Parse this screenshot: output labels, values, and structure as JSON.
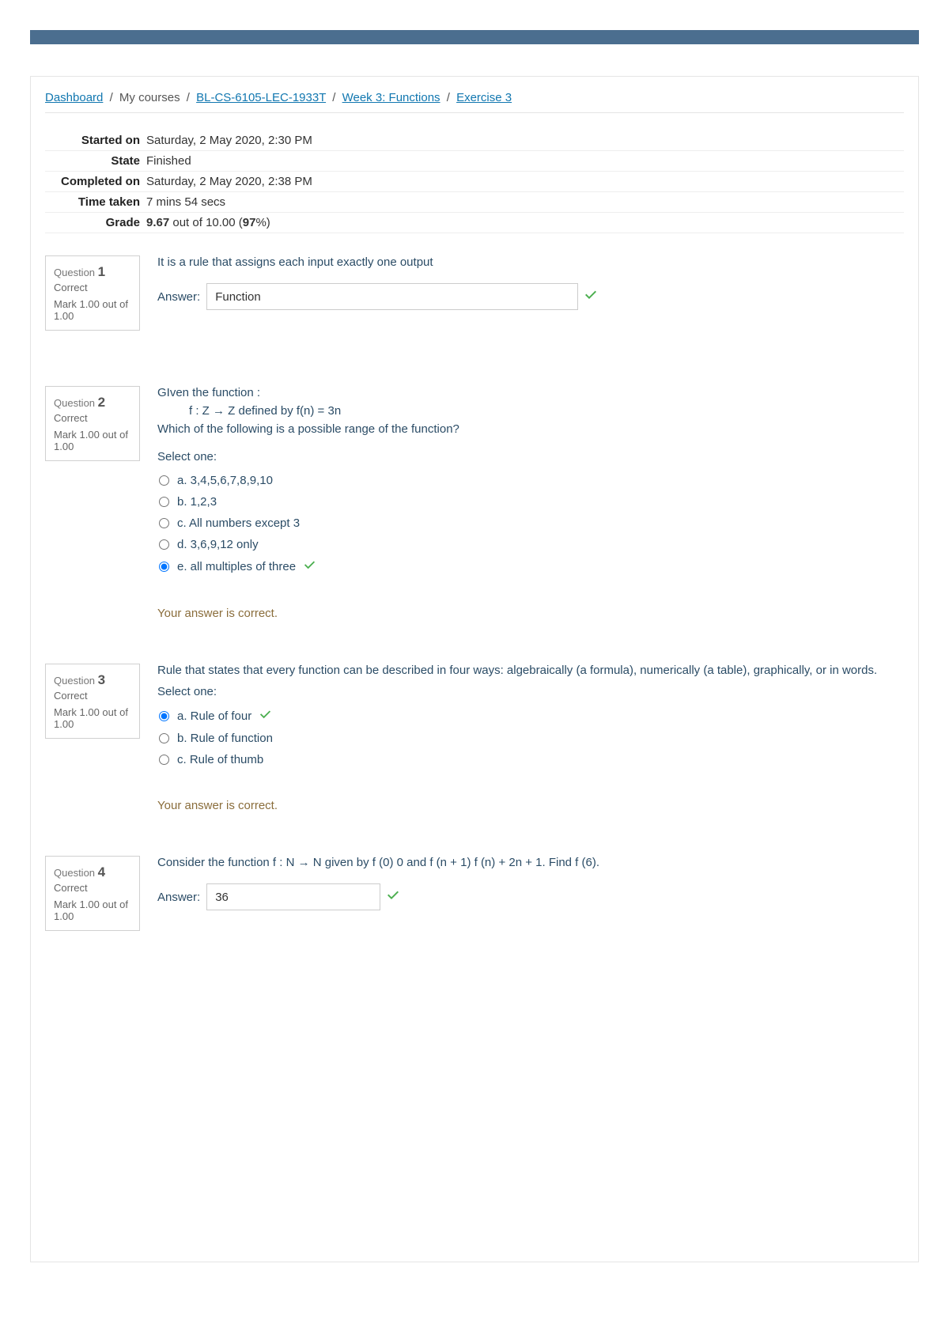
{
  "breadcrumb": {
    "dashboard": "Dashboard",
    "mycourses": "My courses",
    "course": "BL-CS-6105-LEC-1933T",
    "week": "Week 3: Functions",
    "exercise": "Exercise 3"
  },
  "summary": {
    "started_label": "Started on",
    "started_val": "Saturday, 2 May 2020, 2:30 PM",
    "state_label": "State",
    "state_val": "Finished",
    "completed_label": "Completed on",
    "completed_val": "Saturday, 2 May 2020, 2:38 PM",
    "time_label": "Time taken",
    "time_val": "7 mins 54 secs",
    "grade_label": "Grade",
    "grade_score": "9.67",
    "grade_mid": " out of 10.00 (",
    "grade_pct": "97",
    "grade_end": "%)"
  },
  "q_prefix": "Question ",
  "mark_text": "Mark 1.00 out of 1.00",
  "status_correct": "Correct",
  "answer_label": "Answer:",
  "select_one": "Select one:",
  "feedback_correct": "Your answer is correct.",
  "q1": {
    "num": "1",
    "text": "It is a rule that assigns each input exactly one output",
    "answer": "Function"
  },
  "q2": {
    "num": "2",
    "line1": "GIven the function :",
    "line2": "f : Z → Z defined by f(n) =  3n",
    "line3": "Which of the following is a  possible range of the function?",
    "opts": {
      "a": "a. 3,4,5,6,7,8,9,10",
      "b": "b. 1,2,3",
      "c": "c. All numbers except 3",
      "d": "d. 3,6,9,12 only",
      "e": "e. all multiples of three"
    }
  },
  "q3": {
    "num": "3",
    "text": "Rule that states that every function can be described in four ways: algebraically (a formula), numerically (a table), graphically, or in words.",
    "opts": {
      "a": "a. Rule of four",
      "b": "b. Rule of function",
      "c": "c. Rule of thumb"
    }
  },
  "q4": {
    "num": "4",
    "text": "Consider the function f : N → N given by f (0) 0 and f (n + 1) f (n) + 2n + 1. Find f (6).",
    "answer": "36"
  }
}
